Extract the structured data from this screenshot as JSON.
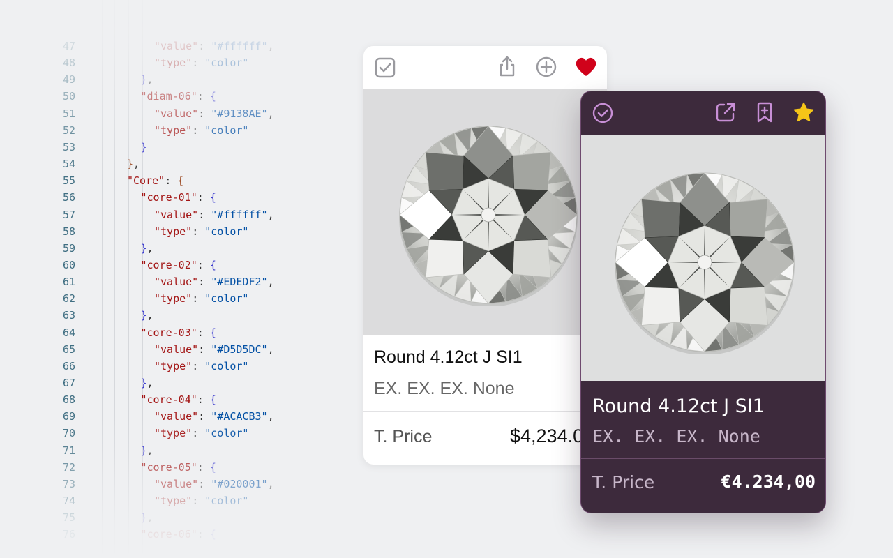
{
  "code_editor": {
    "lines": [
      {
        "n": "47",
        "text": "  \"value\": \"#ffffff\","
      },
      {
        "n": "48",
        "text": "  \"type\": \"color\""
      },
      {
        "n": "49",
        "text": "},"
      },
      {
        "n": "50",
        "text": "\"diam-06\": {"
      },
      {
        "n": "51",
        "text": "  \"value\": \"#9138AE\","
      },
      {
        "n": "52",
        "text": "  \"type\": \"color\""
      },
      {
        "n": "53",
        "text": "}"
      },
      {
        "n": "54",
        "text": "},"
      },
      {
        "n": "55",
        "text": "\"Core\": {"
      },
      {
        "n": "56",
        "text": "\"core-01\": {"
      },
      {
        "n": "57",
        "text": "  \"value\": \"#ffffff\","
      },
      {
        "n": "58",
        "text": "  \"type\": \"color\""
      },
      {
        "n": "59",
        "text": "},"
      },
      {
        "n": "60",
        "text": "\"core-02\": {"
      },
      {
        "n": "61",
        "text": "  \"value\": \"#EDEDF2\","
      },
      {
        "n": "62",
        "text": "  \"type\": \"color\""
      },
      {
        "n": "63",
        "text": "},"
      },
      {
        "n": "64",
        "text": "\"core-03\": {"
      },
      {
        "n": "65",
        "text": "  \"value\": \"#D5D5DC\","
      },
      {
        "n": "66",
        "text": "  \"type\": \"color\""
      },
      {
        "n": "67",
        "text": "},"
      },
      {
        "n": "68",
        "text": "\"core-04\": {"
      },
      {
        "n": "69",
        "text": "  \"value\": \"#ACACB3\","
      },
      {
        "n": "70",
        "text": "  \"type\": \"color\""
      },
      {
        "n": "71",
        "text": "},"
      },
      {
        "n": "72",
        "text": "\"core-05\": {"
      },
      {
        "n": "73",
        "text": "  \"value\": \"#020001\","
      },
      {
        "n": "74",
        "text": "  \"type\": \"color\""
      },
      {
        "n": "75",
        "text": "},"
      },
      {
        "n": "76",
        "text": "\"core-06\": {"
      }
    ]
  },
  "card_light": {
    "icons": [
      "checkbox-checked-icon",
      "share-icon",
      "add-circle-icon",
      "heart-icon"
    ],
    "title": "Round 4.12ct J SI1",
    "specs": "EX. EX. EX. None",
    "price_label": "T. Price",
    "price_value": "$4,234.00",
    "colors": {
      "background": "#ffffff",
      "heart": "#d0021b",
      "icon": "#9a9a9f"
    }
  },
  "card_dark": {
    "icons": [
      "check-circle-icon",
      "external-link-icon",
      "bookmark-add-icon",
      "star-icon"
    ],
    "title": "Round 4.12ct J SI1",
    "specs": "EX. EX. EX. None",
    "price_label": "T. Price",
    "price_value": "€4.234,00",
    "colors": {
      "background": "#3d2a3c",
      "accent": "#c88fd6",
      "star": "#f5c518"
    }
  }
}
